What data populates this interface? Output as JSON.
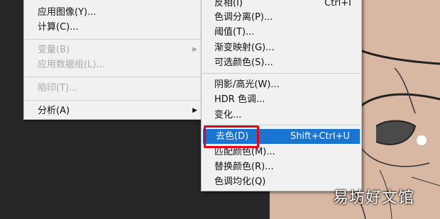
{
  "main_menu": {
    "items": [
      {
        "label": "应用图像(Y)...",
        "disabled": false
      },
      {
        "label": "计算(C)...",
        "disabled": false
      },
      {
        "label": "变量(B)",
        "disabled": true,
        "submenu": true
      },
      {
        "label": "应用数据组(L)...",
        "disabled": true
      },
      {
        "label": "陷印(T)...",
        "disabled": true
      },
      {
        "label": "分析(A)",
        "disabled": false,
        "submenu": true
      }
    ]
  },
  "sub_menu": {
    "items": [
      {
        "label": "反相(I)",
        "shortcut": "Ctrl+I"
      },
      {
        "label": "色调分离(P)..."
      },
      {
        "label": "阈值(T)..."
      },
      {
        "label": "渐变映射(G)..."
      },
      {
        "label": "可选颜色(S)..."
      },
      {
        "label": "阴影/高光(W)..."
      },
      {
        "label": "HDR 色调..."
      },
      {
        "label": "变化..."
      },
      {
        "label": "去色(D)",
        "shortcut": "Shift+Ctrl+U",
        "selected": true
      },
      {
        "label": "匹配颜色(M)..."
      },
      {
        "label": "替换颜色(R)..."
      },
      {
        "label": "色调均化(Q)"
      }
    ]
  },
  "watermark": "易坊好文馆",
  "colors": {
    "selection": "#1c74d1",
    "highlight_box": "#e30613",
    "menu_bg": "#f1f1f1",
    "canvas_bg": "#262626",
    "sketch_bg": "#d9b8a3"
  }
}
